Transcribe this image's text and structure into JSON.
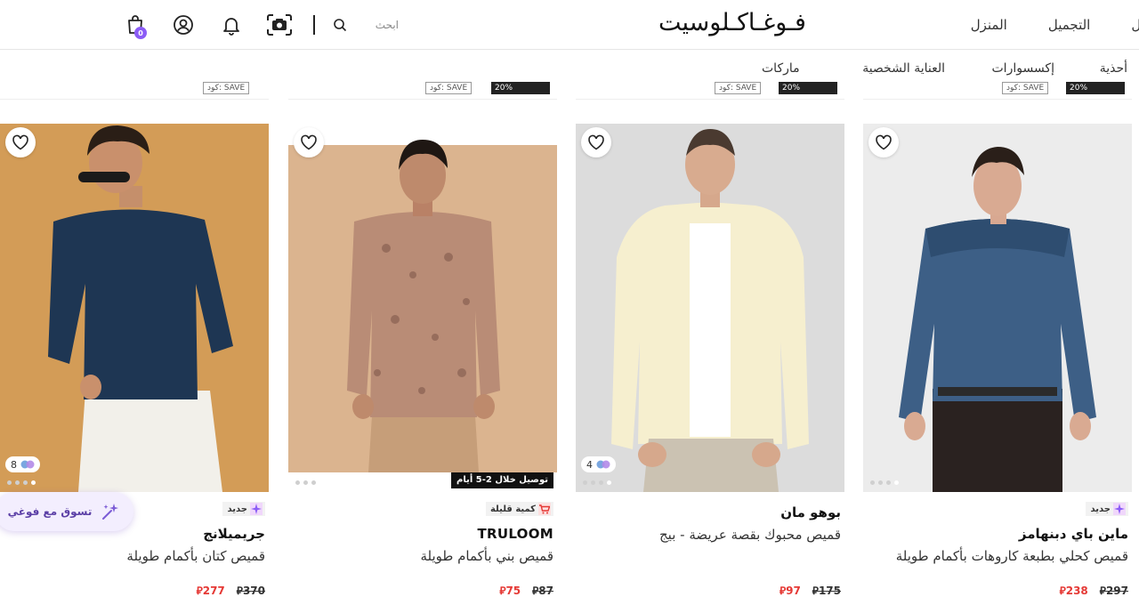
{
  "header": {
    "logo": "فـوغـاكـلوسيت",
    "nav": [
      "فال",
      "التجميل",
      "المنزل"
    ],
    "search_placeholder": "ابحث",
    "bag_count": "0",
    "icons": [
      "bag-icon",
      "user-icon",
      "bell-icon",
      "camera-search-icon",
      "search-icon"
    ]
  },
  "categories": [
    "أحذية",
    "إكسسوارات",
    "العناية الشخصية",
    "ماركات"
  ],
  "previous_row": {
    "code_label": "كود: SAVE",
    "discount_label": "20%"
  },
  "products": [
    {
      "tag": "جديد",
      "brand": "ماين باي دبنهامز",
      "name": "قميص كحلي بطبعة كاروهات بأكمام طويلة",
      "old_price": "297",
      "new_price": "238"
    },
    {
      "tag": "",
      "brand": "بوهو مان",
      "name": "قميص محبوك بقصة عريضة - بيج",
      "old_price": "175",
      "new_price": "97",
      "swatches": "4"
    },
    {
      "tag": "كمية قليلة",
      "brand": "TRULOOM",
      "name": "قميص بني بأكمام طويلة",
      "old_price": "87",
      "new_price": "75",
      "delivery": "توصيل خلال 2-5 أيام"
    },
    {
      "tag": "جديد",
      "brand": "جريميلانج",
      "name": "قميص كتان بأكمام طويلة",
      "old_price": "370",
      "new_price": "277",
      "swatches": "8"
    }
  ],
  "currency_symbol": "⃁",
  "assistant": {
    "label": "تسوق مع فوغي"
  },
  "colors": {
    "accent": "#8b5cf6",
    "sale": "#e53935"
  }
}
